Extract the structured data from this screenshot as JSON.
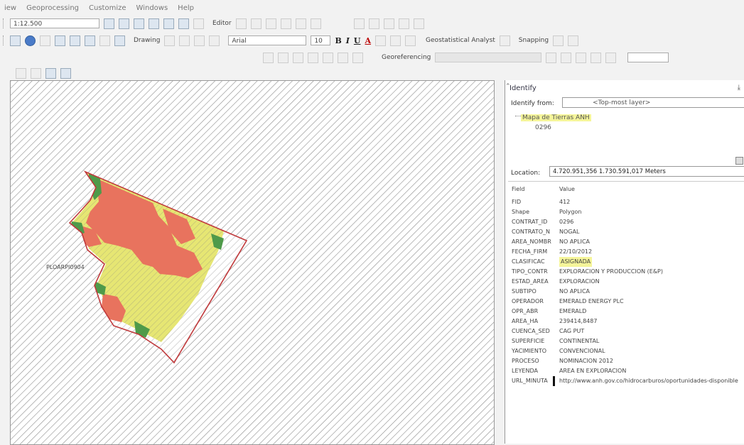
{
  "menu": {
    "items": [
      "iew",
      "Geoprocessing",
      "Customize",
      "Windows",
      "Help"
    ]
  },
  "toolbar1": {
    "scale": "1:12.500",
    "editor": "Editor"
  },
  "toolbar2": {
    "drawing": "Drawing",
    "font": "Arial",
    "font_size": "10",
    "bold": "B",
    "italic": "I",
    "underline": "U",
    "font_color": "A",
    "geostatistical": "Geostatistical Analyst",
    "snapping": "Snapping"
  },
  "toolbar3": {
    "georeferencing": "Georeferencing"
  },
  "map": {
    "labels": {
      "left": "PLOARPI0904"
    },
    "colors": {
      "hatch": "#8c8c8c",
      "outline": "#c0393b",
      "red": "#e8735e",
      "green": "#4f9a4a",
      "yellow": "#e6e673"
    }
  },
  "identify": {
    "title": "Identify",
    "pin": "⤓",
    "identify_from_label": "Identify from:",
    "identify_from_value": "<Top-most layer>",
    "layer": "Mapa de Tierras ANH",
    "feature": "0296",
    "location_label": "Location:",
    "location_value": "4.720.951,356  1.730.591,017 Meters",
    "columns": {
      "field": "Field",
      "value": "Value"
    },
    "rows": [
      {
        "field": "FID",
        "value": "412"
      },
      {
        "field": "Shape",
        "value": "Polygon"
      },
      {
        "field": "CONTRAT_ID",
        "value": "0296"
      },
      {
        "field": "CONTRATO_N",
        "value": "NOGAL"
      },
      {
        "field": "AREA_NOMBR",
        "value": "NO APLICA"
      },
      {
        "field": "FECHA_FIRM",
        "value": "22/10/2012"
      },
      {
        "field": "CLASIFICAC",
        "value": "ASIGNADA"
      },
      {
        "field": "TIPO_CONTR",
        "value": "EXPLORACION Y PRODUCCION (E&P)"
      },
      {
        "field": "ESTAD_AREA",
        "value": "EXPLORACION"
      },
      {
        "field": "SUBTIPO",
        "value": "NO APLICA"
      },
      {
        "field": "OPERADOR",
        "value": "EMERALD ENERGY PLC"
      },
      {
        "field": "OPR_ABR",
        "value": "EMERALD"
      },
      {
        "field": "AREA_HA",
        "value": "239414,8487"
      },
      {
        "field": "CUENCA_SED",
        "value": "CAG PUT"
      },
      {
        "field": "SUPERFICIE",
        "value": "CONTINENTAL"
      },
      {
        "field": "YACIMIENTO",
        "value": "CONVENCIONAL"
      },
      {
        "field": "PROCESO",
        "value": "NOMINACION 2012"
      },
      {
        "field": "LEYENDA",
        "value": "AREA EN EXPLORACION"
      },
      {
        "field": "URL_MINUTA",
        "value": "http://www.anh.gov.co/hidrocarburos/oportunidades-disponible"
      }
    ]
  }
}
